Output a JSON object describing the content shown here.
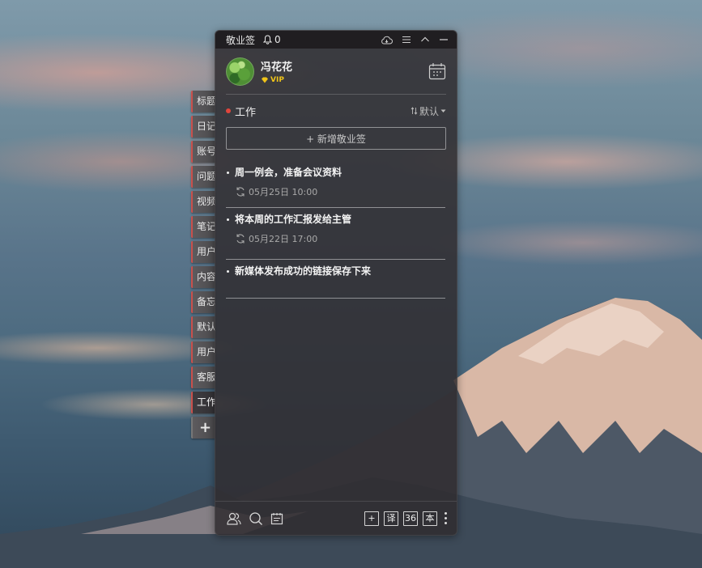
{
  "app": {
    "title": "敬业签",
    "notification_count": "0"
  },
  "user": {
    "name": "冯花花",
    "badge": "VIP"
  },
  "side_tabs": [
    "标题",
    "日记",
    "账号",
    "问题",
    "视频",
    "笔记",
    "用户",
    "内容",
    "备忘",
    "默认",
    "用户",
    "客服",
    "工作"
  ],
  "active_tab_index": 12,
  "section": {
    "title": "工作",
    "sort_label": "默认"
  },
  "add_button_label": "+ 新增敬业签",
  "notes": [
    {
      "text": "周一例会，准备会议资料",
      "time": "05月25日 10:00"
    },
    {
      "text": "将本周的工作汇报发给主管",
      "time": "05月22日 17:00"
    },
    {
      "text": "新媒体发布成功的链接保存下来",
      "time": ""
    }
  ],
  "footer": {
    "buttons": [
      "+",
      "译",
      "36",
      "本"
    ]
  },
  "colors": {
    "accent_red": "#e0453c",
    "vip_gold": "#f0c419",
    "panel_bg": "#302c30"
  }
}
